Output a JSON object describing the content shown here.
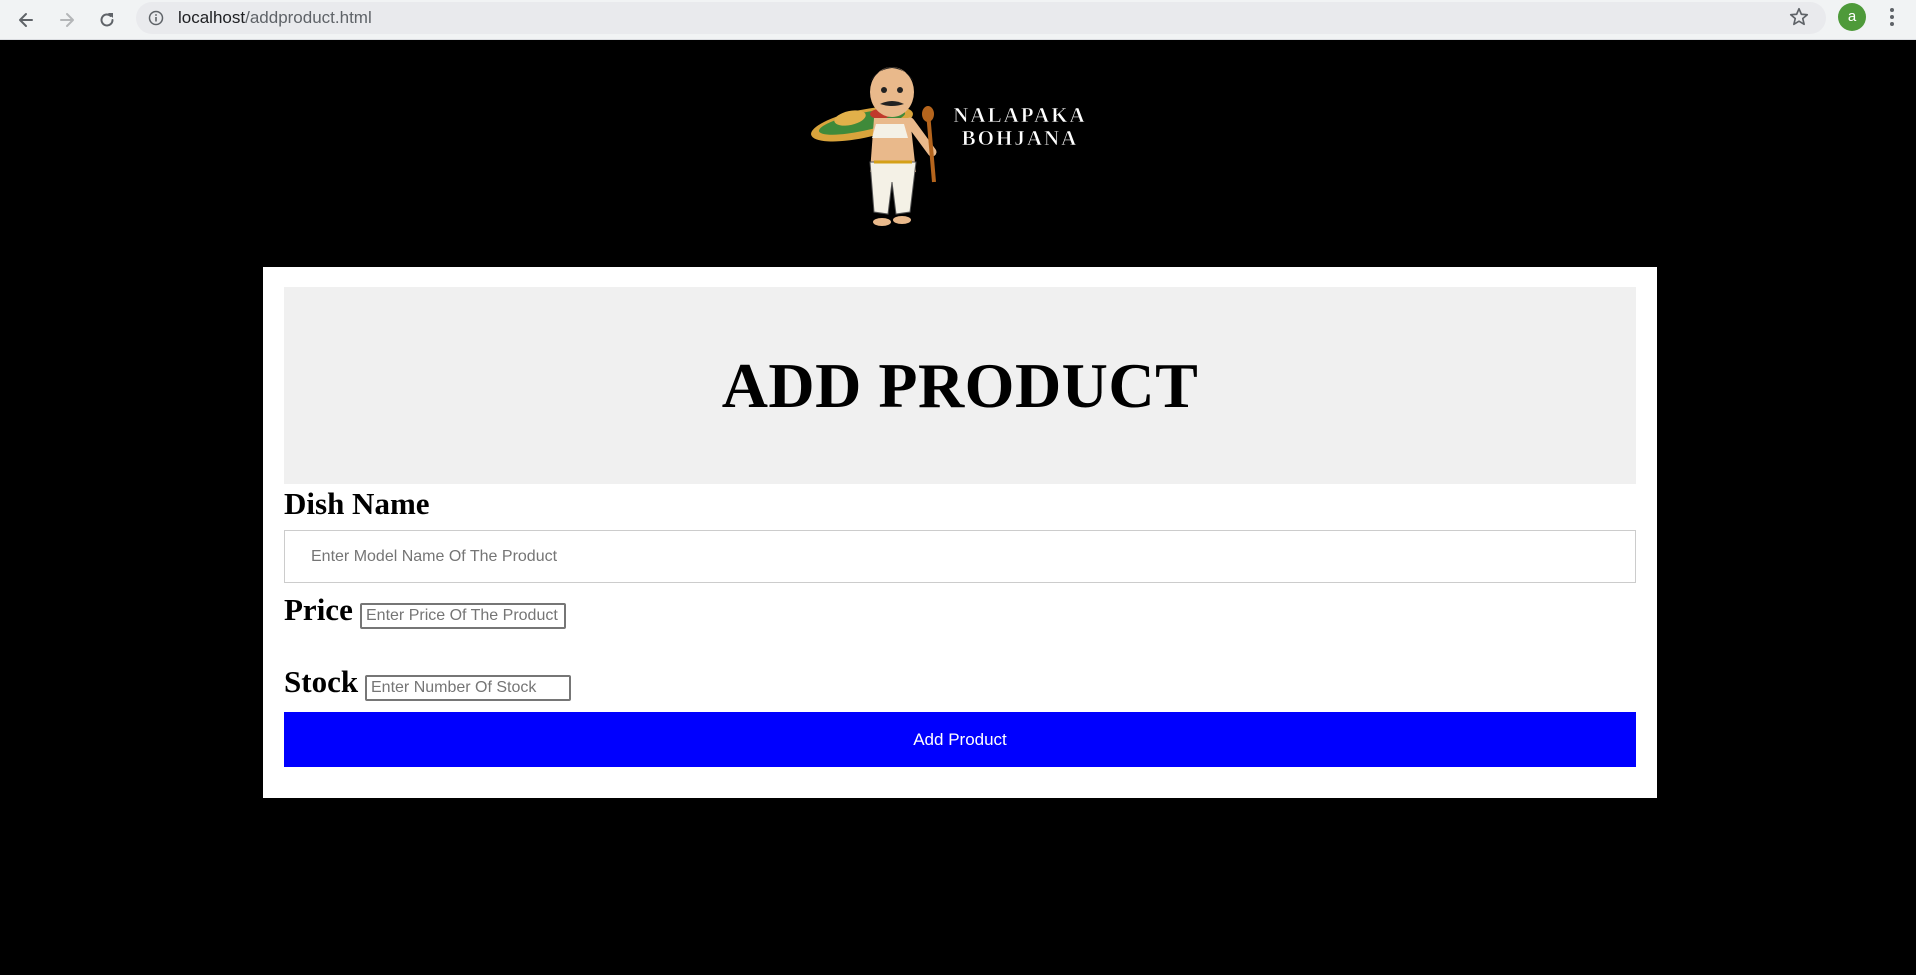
{
  "browser": {
    "url_host": "localhost",
    "url_path": "/addproduct.html",
    "profile_initial": "a",
    "profile_color": "#4e9a3a"
  },
  "logo": {
    "line1": "NALAPAKA",
    "line2": "BOHJANA"
  },
  "form": {
    "title": "ADD PRODUCT",
    "dish_name_label": "Dish Name",
    "dish_name_placeholder": "Enter Model Name Of The Product",
    "price_label": "Price",
    "price_placeholder": "Enter Price Of The Product",
    "stock_label": "Stock",
    "stock_placeholder": "Enter Number Of Stock",
    "submit_label": "Add Product",
    "submit_color": "#0000ff"
  },
  "icons": {
    "back": "back-arrow-icon",
    "forward": "forward-arrow-icon",
    "reload": "reload-icon",
    "info": "info-icon",
    "bookmark": "star-icon",
    "menu": "kebab-menu-icon"
  }
}
